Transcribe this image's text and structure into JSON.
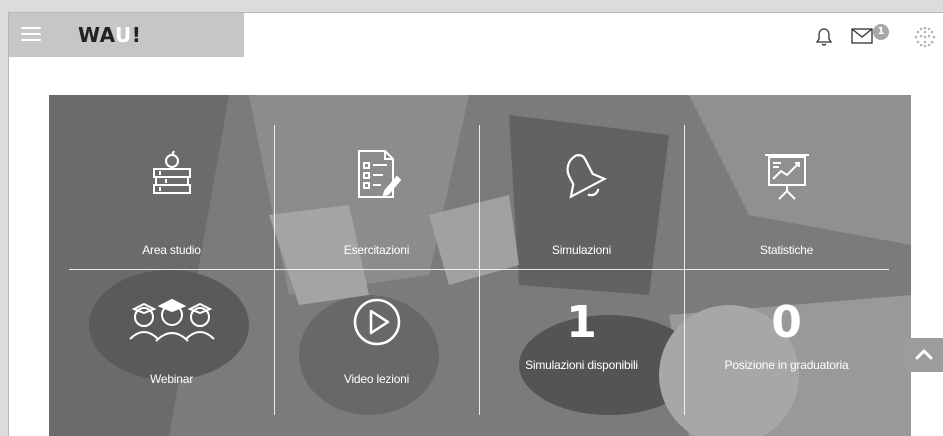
{
  "header": {
    "logo_prefix": "WA",
    "logo_u": "U",
    "logo_suffix": "!",
    "mail_badge": "1",
    "icons": [
      "menu-icon",
      "bell-icon",
      "mail-icon",
      "globe-icon"
    ]
  },
  "tiles": [
    {
      "label": "Area studio",
      "icon": "books-apple-icon"
    },
    {
      "label": "Esercitazioni",
      "icon": "checklist-icon"
    },
    {
      "label": "Simulazioni",
      "icon": "bell-icon"
    },
    {
      "label": "Statistiche",
      "icon": "chart-board-icon"
    },
    {
      "label": "Webinar",
      "icon": "graduates-icon"
    },
    {
      "label": "Video lezioni",
      "icon": "play-icon"
    },
    {
      "label": "Simulazioni disponibili",
      "value": "1"
    },
    {
      "label": "Posizione in graduatoria",
      "value": "0"
    }
  ],
  "colors": {
    "brand_bar": "#c6c6c6",
    "hero_tint": "#9a9a9a",
    "tile_text": "#ffffff"
  }
}
